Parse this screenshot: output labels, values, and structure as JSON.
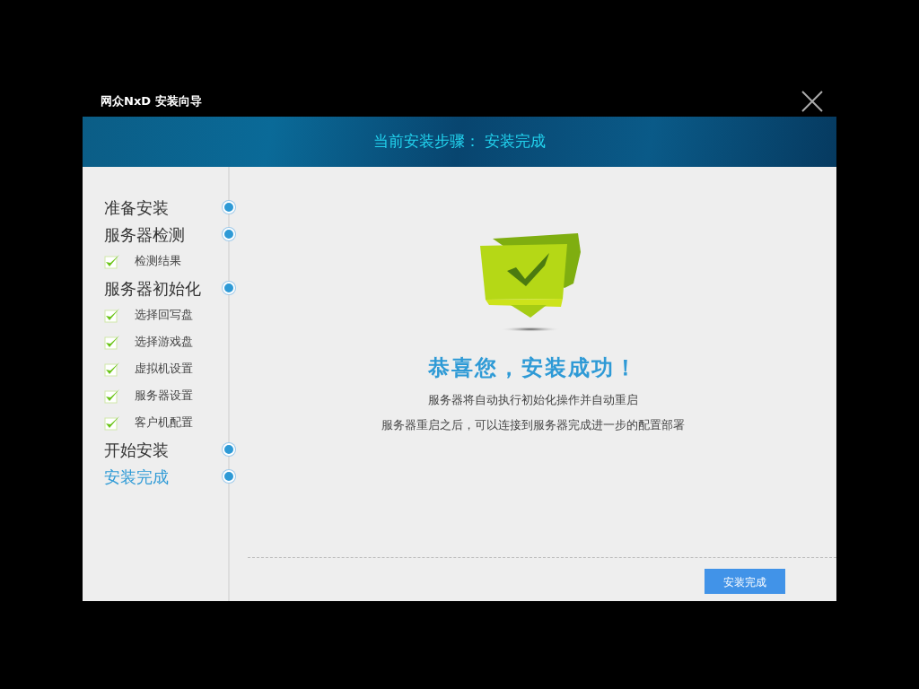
{
  "window": {
    "title": "网众NxD 安装向导"
  },
  "banner": {
    "text": "当前安装步骤： 安装完成"
  },
  "steps": [
    {
      "kind": "step",
      "label": "准备安装",
      "selected": false
    },
    {
      "kind": "step",
      "label": "服务器检测",
      "selected": false
    },
    {
      "kind": "substep",
      "label": "检测结果",
      "checked": true,
      "selected": false
    },
    {
      "kind": "step",
      "label": "服务器初始化",
      "selected": false
    },
    {
      "kind": "substep",
      "label": "选择回写盘",
      "checked": true,
      "selected": false
    },
    {
      "kind": "substep",
      "label": "选择游戏盘",
      "checked": true,
      "selected": false
    },
    {
      "kind": "substep",
      "label": "虚拟机设置",
      "checked": true,
      "selected": false
    },
    {
      "kind": "substep",
      "label": "服务器设置",
      "checked": true,
      "selected": false
    },
    {
      "kind": "substep",
      "label": "客户机配置",
      "checked": true,
      "selected": false
    },
    {
      "kind": "step",
      "label": "开始安装",
      "selected": false
    },
    {
      "kind": "step",
      "label": "安装完成",
      "selected": true
    }
  ],
  "content": {
    "headline": "恭喜您，安装成功！",
    "lines": [
      "服务器将自动执行初始化操作并自动重启",
      "服务器重启之后，可以连接到服务器完成进一步的配置部署"
    ]
  },
  "buttons": [
    {
      "label": "安装完成"
    }
  ]
}
